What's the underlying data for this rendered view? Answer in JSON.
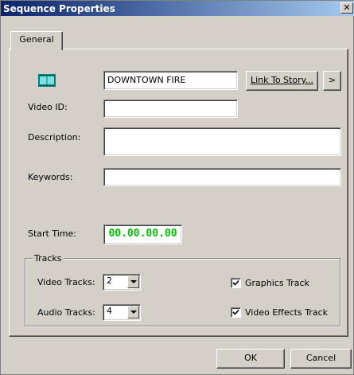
{
  "window": {
    "title": "Sequence Properties",
    "close_glyph": "✕"
  },
  "tabs": [
    {
      "label": "General",
      "selected": true
    }
  ],
  "general": {
    "story_name": "DOWNTOWN FIRE",
    "link_to_story_label": "Link To Story...",
    "more_glyph": ">",
    "video_id_label": "Video ID:",
    "video_id_value": "",
    "description_label": "Description:",
    "description_value": "",
    "keywords_label": "Keywords:",
    "keywords_value": "",
    "start_time_label": "Start Time:",
    "start_time_value": "00.00.00.00",
    "start_time_color": "#00c000"
  },
  "tracks": {
    "group_label": "Tracks",
    "video_tracks_label": "Video Tracks:",
    "video_tracks_value": "2",
    "audio_tracks_label": "Audio Tracks:",
    "audio_tracks_value": "4",
    "graphics_track_label": "Graphics Track",
    "graphics_track_checked": true,
    "video_effects_track_label": "Video Effects Track",
    "video_effects_track_checked": true
  },
  "buttons": {
    "ok_label": "OK",
    "cancel_label": "Cancel"
  },
  "colors": {
    "titlebar_start": "#0a246a",
    "titlebar_end": "#a6caf0",
    "dialog_bg": "#d4d0c8",
    "film_icon": "#008080"
  },
  "icons": {
    "sequence": "film-strip-icon"
  }
}
